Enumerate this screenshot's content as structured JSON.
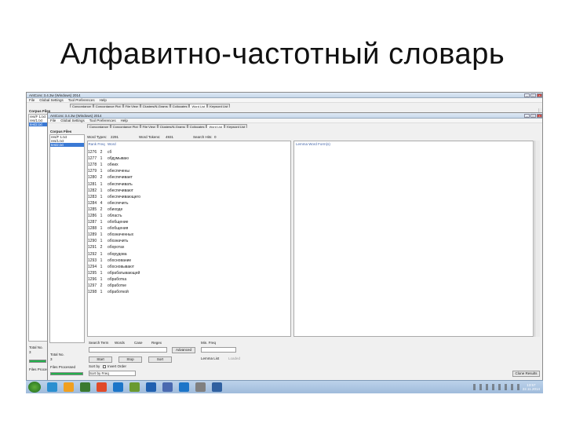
{
  "slide": {
    "title": "Алфавитно-частотный словарь"
  },
  "outer_window": {
    "title": "AntConc 3.4.3w (Windows) 2014",
    "menu": [
      "File",
      "Global Settings",
      "Tool Preferences",
      "Help"
    ],
    "corpus_files_label": "Corpus Files",
    "files": [
      "res/F 1.txt",
      "res/1.txt",
      "test2.txt"
    ],
    "tabs": [
      "Concordance",
      "Concordance Plot",
      "File View",
      "Clusters/N-Grams",
      "Collocates",
      "Word List",
      "Keyword List"
    ],
    "total_label": "Total No.",
    "total_value": "3",
    "files_processed_label": "Files Processed",
    "start_button": "Start"
  },
  "inner_window": {
    "title": "AntConc 3.4.3w (Windows) 2014",
    "menu": [
      "File",
      "Global Settings",
      "Tool Preferences",
      "Help"
    ],
    "corpus_files_label": "Corpus Files",
    "files": [
      "res/F 1.txt",
      "res/1.txt",
      "test2.txt"
    ],
    "tabs": [
      "Concordance",
      "Concordance Plot",
      "File View",
      "Clusters/N-Grams",
      "Collocates",
      "Word List",
      "Keyword List"
    ],
    "stats": {
      "word_types_label": "Word Types:",
      "word_types": "2291",
      "word_tokens_label": "Word Tokens:",
      "word_tokens": "4931",
      "search_hits_label": "Search Hits:",
      "search_hits": "0"
    },
    "columns": {
      "rank": "Rank",
      "freq": "Freq",
      "word": "Word",
      "lemma": "Lemma Word Form(s)"
    },
    "rows": [
      {
        "rank": "1276",
        "freq": "2",
        "word": "сб"
      },
      {
        "rank": "1277",
        "freq": "1",
        "word": "обдумываю"
      },
      {
        "rank": "1278",
        "freq": "1",
        "word": "обеих"
      },
      {
        "rank": "1279",
        "freq": "1",
        "word": "обеспечены"
      },
      {
        "rank": "1280",
        "freq": "2",
        "word": "обеспечивает"
      },
      {
        "rank": "1281",
        "freq": "1",
        "word": "обеспечивать"
      },
      {
        "rank": "1282",
        "freq": "1",
        "word": "обеспечивают"
      },
      {
        "rank": "1283",
        "freq": "1",
        "word": "обеспечивающего"
      },
      {
        "rank": "1284",
        "freq": "4",
        "word": "обеспечить"
      },
      {
        "rank": "1285",
        "freq": "2",
        "word": "обиходе"
      },
      {
        "rank": "1286",
        "freq": "1",
        "word": "область"
      },
      {
        "rank": "1287",
        "freq": "1",
        "word": "обобщение"
      },
      {
        "rank": "1288",
        "freq": "1",
        "word": "обобщения"
      },
      {
        "rank": "1289",
        "freq": "1",
        "word": "обозначенных"
      },
      {
        "rank": "1290",
        "freq": "1",
        "word": "обозначить"
      },
      {
        "rank": "1291",
        "freq": "2",
        "word": "оборотах"
      },
      {
        "rank": "1292",
        "freq": "1",
        "word": "оборудова"
      },
      {
        "rank": "1293",
        "freq": "1",
        "word": "обоснование"
      },
      {
        "rank": "1294",
        "freq": "1",
        "word": "обосновывают"
      },
      {
        "rank": "1295",
        "freq": "1",
        "word": "обрабатывающей"
      },
      {
        "rank": "1296",
        "freq": "1",
        "word": "обработка"
      },
      {
        "rank": "1297",
        "freq": "2",
        "word": "обработке"
      },
      {
        "rank": "1298",
        "freq": "1",
        "word": "обработкой"
      }
    ],
    "search_term_label": "Search Term",
    "search_options": [
      "Words",
      "Case",
      "Regex"
    ],
    "advanced_button": "Advanced",
    "min_freq_label": "Min. Freq",
    "lemma_list_label": "Lemma List",
    "loaded_label": "Loaded",
    "start_button": "Start",
    "stop_button": "Stop",
    "sort_button": "Sort",
    "sort_by_label": "Sort by",
    "invert_order_label": "Invert Order",
    "sort_by_value": "Sort by Freq",
    "total_label": "Total No.",
    "total_value": "3",
    "files_processed_label": "Files Processed",
    "clone_results_button": "Clone Results"
  },
  "taskbar": {
    "time": "13:57",
    "date": "22.11.2014",
    "icon_colors": [
      "#2a8fd0",
      "#f0a020",
      "#3a7a30",
      "#e04a2a",
      "#1c75c8",
      "#6a9a30",
      "#2060b0",
      "#4a6ab0",
      "#1c75c8",
      "#808080",
      "#3060a0"
    ]
  }
}
